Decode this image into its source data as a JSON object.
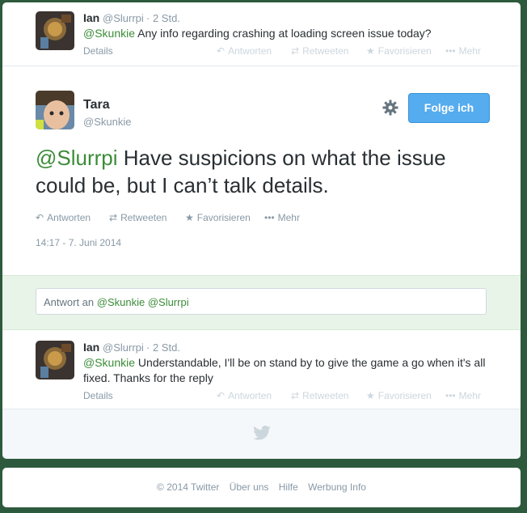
{
  "tweet_prev": {
    "name": "Ian",
    "handle": "@Slurrpi",
    "time": "· 2 Std.",
    "mention": "@Skunkie",
    "text": " Any info regarding crashing at loading screen issue today?",
    "details": "Details",
    "actions": {
      "reply": "Antworten",
      "retweet": "Retweeten",
      "favorite": "Favorisieren",
      "more": "Mehr"
    }
  },
  "main_tweet": {
    "name": "Tara",
    "handle": "@Skunkie",
    "follow_label": "Folge ich",
    "mention": "@Slurrpi",
    "text": " Have suspicions on what the issue could be, but I can’t talk details.",
    "actions": {
      "reply": "Antworten",
      "retweet": "Retweeten",
      "favorite": "Favorisieren",
      "more": "Mehr"
    },
    "timestamp": "14:17 - 7. Juni 2014"
  },
  "reply_box": {
    "prefix": "Antwort an ",
    "mentions": "@Skunkie @Slurrpi"
  },
  "tweet_next": {
    "name": "Ian",
    "handle": "@Slurrpi",
    "time": "· 2 Std.",
    "mention": "@Skunkie",
    "text": " Understandable, I'll be on stand by to give the game a go when it's all fixed. Thanks for the reply",
    "details": "Details",
    "actions": {
      "reply": "Antworten",
      "retweet": "Retweeten",
      "favorite": "Favorisieren",
      "more": "Mehr"
    }
  },
  "footer": {
    "copyright": "© 2014 Twitter",
    "links": [
      "Über uns",
      "Hilfe",
      "Werbung Info"
    ]
  },
  "colors": {
    "accent": "#3b8c38",
    "follow_button": "#55acee",
    "reply_area": "#e8f4e8"
  }
}
